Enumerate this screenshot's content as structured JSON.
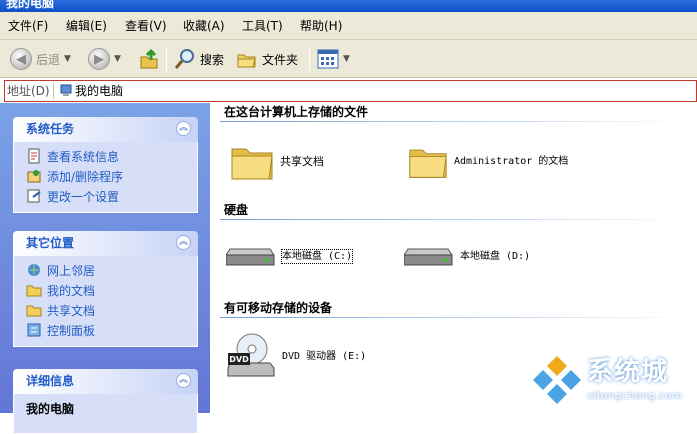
{
  "window": {
    "title": "我的电脑"
  },
  "menu": [
    "文件(F)",
    "编辑(E)",
    "查看(V)",
    "收藏(A)",
    "工具(T)",
    "帮助(H)"
  ],
  "toolbar": {
    "back_label": "后退",
    "search_label": "搜索",
    "folders_label": "文件夹"
  },
  "address": {
    "label": "地址(D)",
    "value": "我的电脑"
  },
  "sidebar": {
    "system_tasks": {
      "title": "系统任务",
      "items": [
        "查看系统信息",
        "添加/删除程序",
        "更改一个设置"
      ]
    },
    "other_places": {
      "title": "其它位置",
      "items": [
        "网上邻居",
        "我的文档",
        "共享文档",
        "控制面板"
      ]
    },
    "details": {
      "title": "详细信息",
      "name": "我的电脑"
    }
  },
  "main": {
    "files_group": {
      "title": "在这台计算机上存储的文件",
      "items": [
        "共享文档",
        "Administrator 的文档"
      ]
    },
    "drives_group": {
      "title": "硬盘",
      "items": [
        "本地磁盘 (C:)",
        "本地磁盘 (D:)"
      ]
    },
    "removable_group": {
      "title": "有可移动存储的设备",
      "items": [
        "DVD 驱动器 (E:)"
      ],
      "dvd_badge": "DVD"
    }
  },
  "watermark": {
    "brand": "系统城",
    "url": "xitongcheng.com"
  }
}
